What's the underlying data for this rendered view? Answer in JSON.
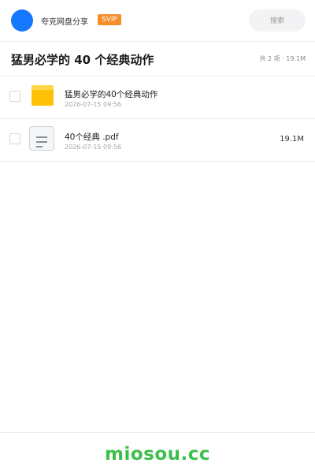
{
  "header": {
    "user_name": "夸克网盘分享",
    "badge": "SVIP",
    "search_placeholder": "搜索",
    "avatar_color": "#1677ff"
  },
  "folder": {
    "title": "猛男必学的 40 个经典动作",
    "summary": "共 2 项 · 19.1M"
  },
  "files": [
    {
      "name": "猛男必学的40个经典动作",
      "date": "2026-07-15 09:56",
      "size": "",
      "icon": "folder-icon"
    },
    {
      "name": "40个经典 .pdf",
      "date": "2026-07-15 09:56",
      "size": "19.1M",
      "icon": "document-icon"
    }
  ],
  "footer": {
    "watermark": "miosou.cc",
    "watermark_color": "#3cbf4a"
  },
  "colors": {
    "accent": "#1677ff",
    "badge": "#f78c2a",
    "folder": "#ffc107"
  }
}
